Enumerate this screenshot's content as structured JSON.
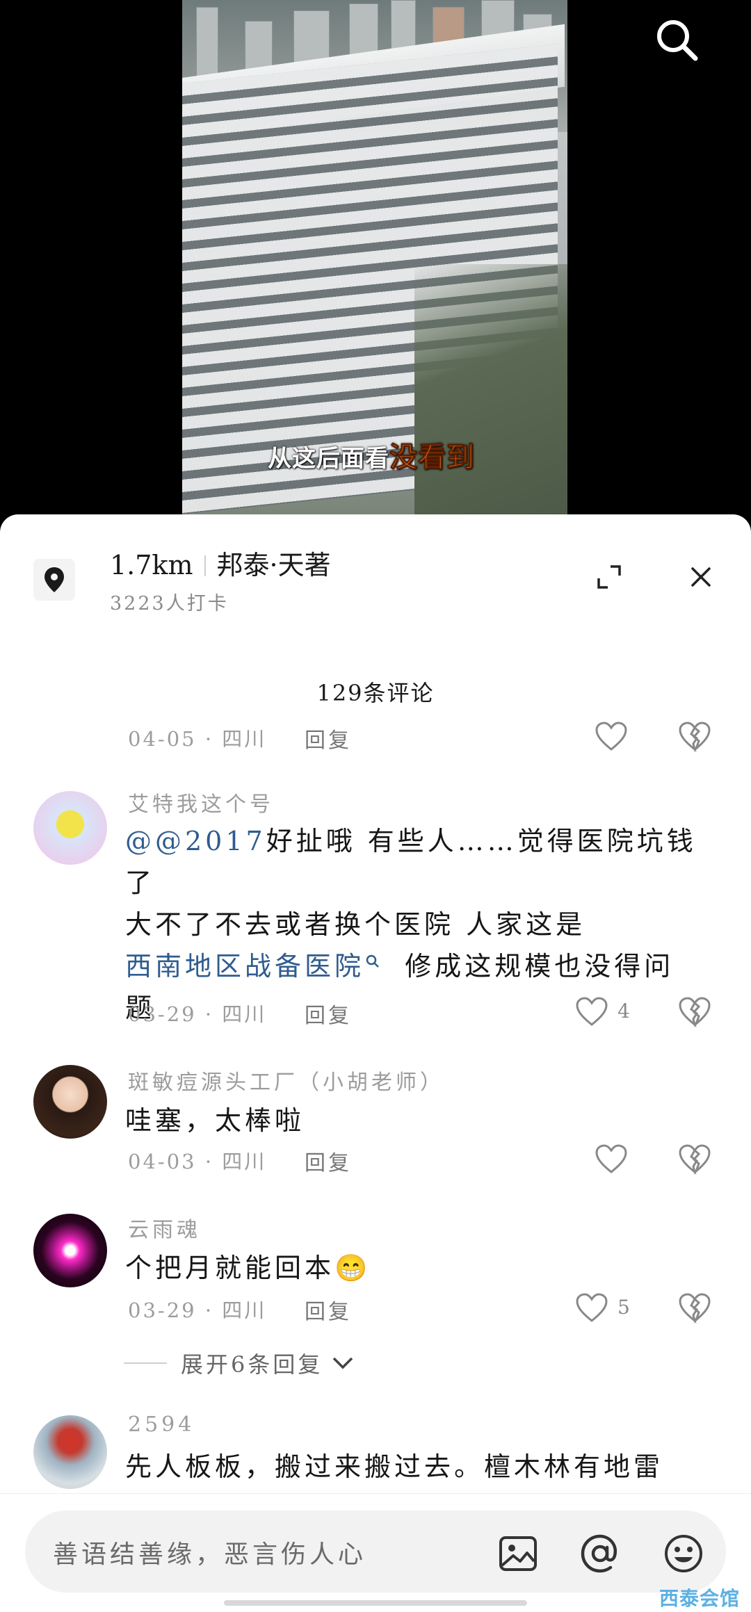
{
  "video": {
    "subtitle_prefix": "从这后面看",
    "subtitle_highlight": "没看到",
    "search_icon": "search-icon"
  },
  "location": {
    "distance": "1.7km",
    "name": "邦泰·天著",
    "checkins": "3223人打卡",
    "icon": "location-pin-icon"
  },
  "comments_header": {
    "title": "129条评论"
  },
  "comments": [
    {
      "partial": true,
      "date": "04-05",
      "region": "四川",
      "reply_label": "回复",
      "likes": ""
    },
    {
      "username": "艾特我这个号",
      "mention": "@@2017",
      "line1_rest": "好扯哦 有些人……觉得医院坑钱了",
      "line2": "大不了不去或者换个医院  人家这是",
      "link_text": "西南地区战备医院",
      "line3_rest": "修成这规模也没得问",
      "line4": "题",
      "date": "03-29",
      "region": "四川",
      "reply_label": "回复",
      "likes": "4"
    },
    {
      "username": "斑敏痘源头工厂（小胡老师）",
      "text": "哇塞，太棒啦",
      "date": "04-03",
      "region": "四川",
      "reply_label": "回复",
      "likes": ""
    },
    {
      "username": "云雨魂",
      "text": "个把月就能回本",
      "emoji": "😁",
      "date": "03-29",
      "region": "四川",
      "reply_label": "回复",
      "likes": "5",
      "expand_label": "展开6条回复"
    },
    {
      "username": "2594",
      "text": "先人板板，搬过来搬过去。檀木林有地雷"
    }
  ],
  "input": {
    "placeholder": "善语结善缘，恶言伤人心",
    "icons": [
      "image-icon",
      "at-icon",
      "emoji-icon"
    ]
  },
  "watermark": "西泰会馆",
  "colors": {
    "link": "#2f5c8f",
    "subtitle_highlight": "#ff7a1a"
  }
}
